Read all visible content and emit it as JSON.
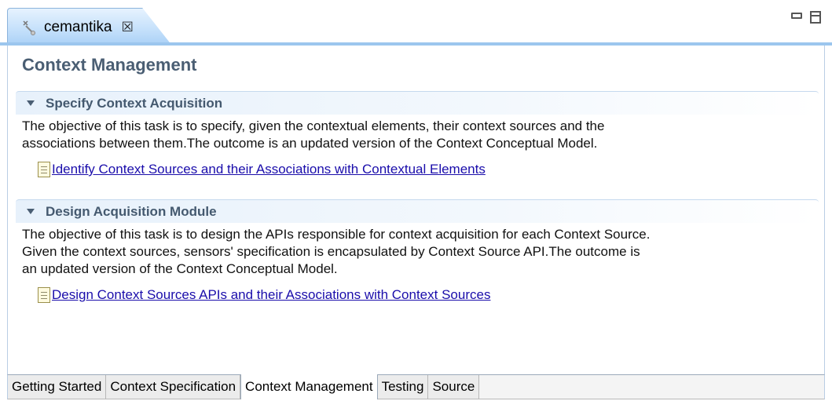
{
  "editor_tab": {
    "label": "cemantika",
    "close_glyph": "☒"
  },
  "page_title": "Context Management",
  "sections": [
    {
      "title": "Specify Context Acquisition",
      "description_lines": [
        "The objective of this task is to specify, given the contextual elements, their context sources and the",
        "associations between them.The outcome is an updated version of the Context Conceptual Model."
      ],
      "link": "Identify Context Sources and their Associations with Contextual Elements"
    },
    {
      "title": "Design Acquisition Module",
      "description_lines": [
        "The objective of this task is to design the APIs responsible for context acquisition for each Context Source.",
        "Given the context sources, sensors' specification is encapsulated by Context Source API.The outcome is",
        "an updated version of the Context Conceptual Model."
      ],
      "link": "Design Context Sources APIs and their Associations with Context Sources"
    }
  ],
  "bottom_tabs": [
    {
      "label": "Getting Started",
      "active": false
    },
    {
      "label": "Context Specification",
      "active": false
    },
    {
      "label": "Context Management",
      "active": true
    },
    {
      "label": "Testing",
      "active": false
    },
    {
      "label": "Source",
      "active": false
    }
  ],
  "colors": {
    "title": "#4a5e73",
    "link": "#1a0dab",
    "tab_highlight": "#9cc6ee"
  },
  "icons": {
    "editor_tab": "plugin-manifest-icon",
    "section_toggle": "twisty-expanded-icon",
    "task_link": "cheatsheet-doc-icon",
    "minimize": "minimize-icon",
    "maximize": "maximize-icon"
  }
}
